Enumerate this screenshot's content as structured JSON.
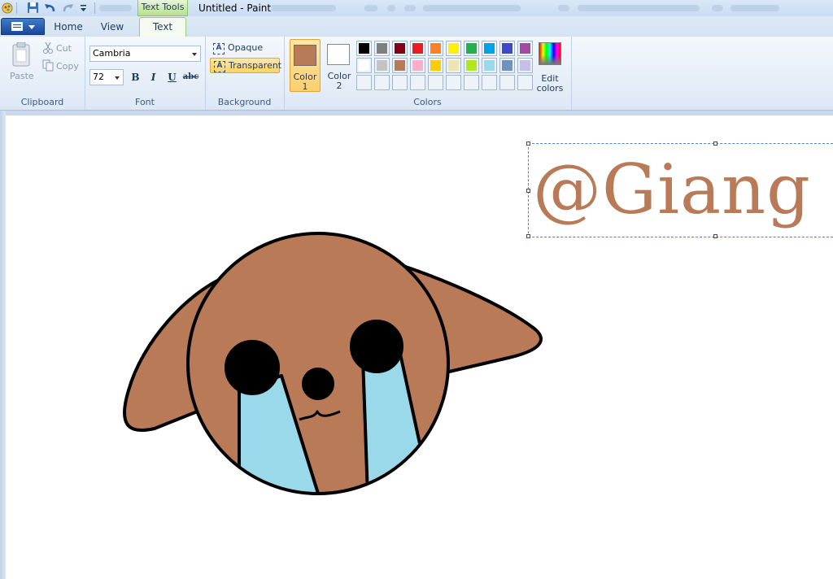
{
  "window": {
    "title": "Untitled - Paint",
    "contextual_tab": "Text Tools"
  },
  "tabs": [
    {
      "label": "Home"
    },
    {
      "label": "View"
    },
    {
      "label": "Text"
    }
  ],
  "clipboard": {
    "paste": "Paste",
    "cut": "Cut",
    "copy": "Copy",
    "group_label": "Clipboard"
  },
  "font": {
    "family": "Cambria",
    "size": "72",
    "bold": "B",
    "italic": "I",
    "underline": "U",
    "strikethrough": "abc",
    "group_label": "Font"
  },
  "background": {
    "opaque": "Opaque",
    "transparent": "Transparent",
    "selected": "Transparent",
    "group_label": "Background"
  },
  "colors": {
    "color1_label_line1": "Color",
    "color1_label_line2": "1",
    "color2_label_line1": "Color",
    "color2_label_line2": "2",
    "color1_value": "#b97a57",
    "color2_value": "#ffffff",
    "edit_colors_line1": "Edit",
    "edit_colors_line2": "colors",
    "group_label": "Colors",
    "palette_row1": [
      "#000000",
      "#7f7f7f",
      "#880015",
      "#ed1c24",
      "#ff7f27",
      "#fff200",
      "#22b14c",
      "#00a2e8",
      "#3f48cc",
      "#a349a4"
    ],
    "palette_row2": [
      "#ffffff",
      "#c3c3c3",
      "#b97a57",
      "#ffaec9",
      "#ffc90e",
      "#efe4b0",
      "#b5e61d",
      "#99d9ea",
      "#7092be",
      "#c8bfe7"
    ]
  },
  "canvas": {
    "text": "@Giang",
    "text_color": "#b97a57",
    "drawing": "crying-puppy-face"
  }
}
